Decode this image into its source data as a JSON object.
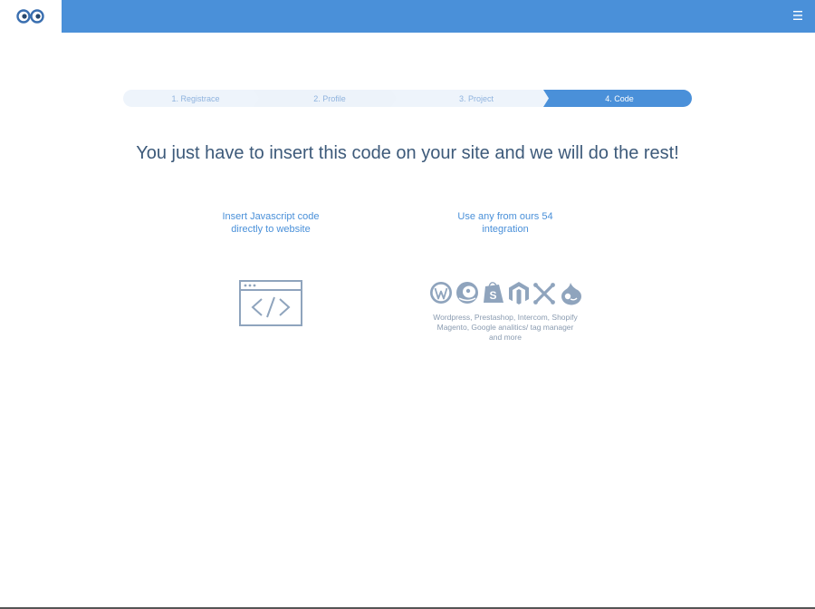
{
  "header": {
    "menu_glyph": "☰",
    "brand_color": "#4a90d9"
  },
  "stepper": {
    "steps": [
      {
        "label": "1. Registrace",
        "active": false
      },
      {
        "label": "2. Profile",
        "active": false
      },
      {
        "label": "3. Project",
        "active": false
      },
      {
        "label": "4. Code",
        "active": true
      }
    ],
    "inactive_color": "#eef4fb",
    "active_color": "#4a90d9"
  },
  "main": {
    "headline": "You just have to insert this code on your site and we will do the rest!",
    "option_js": {
      "line1": "Insert Javascript code",
      "line2": "directly to website",
      "icon": "code-window-icon"
    },
    "option_integration": {
      "line1": "Use any from ours 54",
      "line2": "integration",
      "icons": [
        "wordpress-icon",
        "prestashop-icon",
        "shopify-icon",
        "magento-icon",
        "joomla-icon",
        "drupal-icon"
      ],
      "desc_line1": "Wordpress, Prestashop, Intercom, Shopify",
      "desc_line2": "Magento, Google analitics/ tag manager",
      "desc_line3": "and more"
    }
  }
}
